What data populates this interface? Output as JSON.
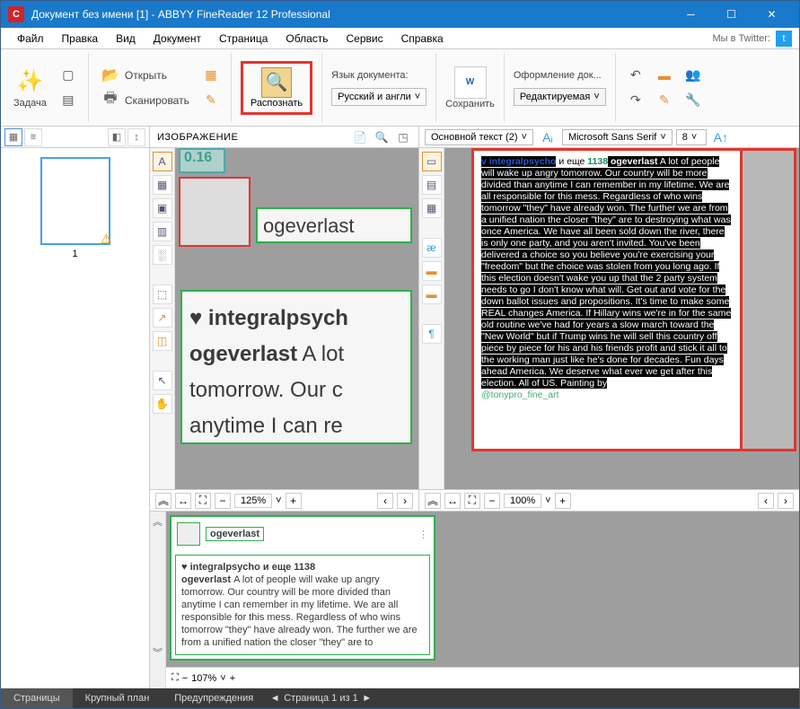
{
  "titlebar": {
    "title": "Документ без имени [1] - ABBYY FineReader 12 Professional"
  },
  "menu": {
    "file": "Файл",
    "edit": "Правка",
    "view": "Вид",
    "document": "Документ",
    "page": "Страница",
    "area": "Область",
    "service": "Сервис",
    "help": "Справка",
    "twitter_label": "Мы в Twitter:"
  },
  "toolbar": {
    "task": "Задача",
    "open": "Открыть",
    "scan": "Сканировать",
    "recognize": "Распознать",
    "lang_label": "Язык документа:",
    "lang_value": "Русский и англи",
    "save": "Сохранить",
    "save_icon": "W",
    "design_label": "Оформление док...",
    "design_value": "Редактируемая"
  },
  "imagepane": {
    "header": "ИЗОБРАЖЕНИЕ",
    "zoom": "125%",
    "zone_badge": "0.16",
    "zone_text1": "ogeverlast",
    "zone_heart": "♥",
    "zone_line1": "integralpsych",
    "zone_line2_a": "ogeverlast",
    "zone_line2_b": " A lot",
    "zone_line3": "tomorrow. Our c",
    "zone_line4": "anytime I can re"
  },
  "thumbnail": {
    "page": "1"
  },
  "textpane": {
    "style": "Основной текст (2)",
    "font": "Microsoft Sans Serif",
    "size": "8",
    "zoom": "100%",
    "body_prefix_bold": "v integralpsycho",
    "body_and": " и еще ",
    "body_num": "1138",
    "body_user": " ogeverlast",
    "body_text": " A lot of people will wake up angry tomorrow. Our country will be more divided than anytime I can remember in my lifetime. We are all responsible for this mess. Regardless of who wins tomorrow \"they\" have already won. The further we are from a unified nation the closer \"they\" are to destroying what was once America. We have all been sold down the river, there is only one party, and you aren't invited. You've been delivered a choice so you believe you're exercising your \"freedom\" but the choice was stolen from you long ago. If this election doesn't wake you up that the 2 party system needs to go I don't know what will. Get out and vote for the down ballot issues and propositions. It's time to make some REAL changes America. If Hillary wins we're in for the same old routine we've had for years a slow march toward the \"New World\" but if Trump wins he will sell this country off piece by piece for his and his friends profit and stick it all to the working man just like he's done for decades. Fun days ahead America. We deserve what ever we get after this election. All of US. Painting by",
    "body_tail": "@tonypro_fine_art"
  },
  "bottom": {
    "zoom": "107%",
    "user": "ogeverlast",
    "line1": "♥ integralpsycho и еще 1138",
    "line2a": "ogeverlast ",
    "line2b": "A lot of people will wake up angry tomorrow. Our country will be more divided than anytime I can remember in my lifetime. We are all responsible for this mess. Regardless of who wins tomorrow \"they\" have already won. The further we are from a unified nation the closer \"they\" are to"
  },
  "status": {
    "pages": "Страницы",
    "closeup": "Крупный план",
    "warnings": "Предупреждения",
    "page_of": "Страница 1 из 1"
  }
}
